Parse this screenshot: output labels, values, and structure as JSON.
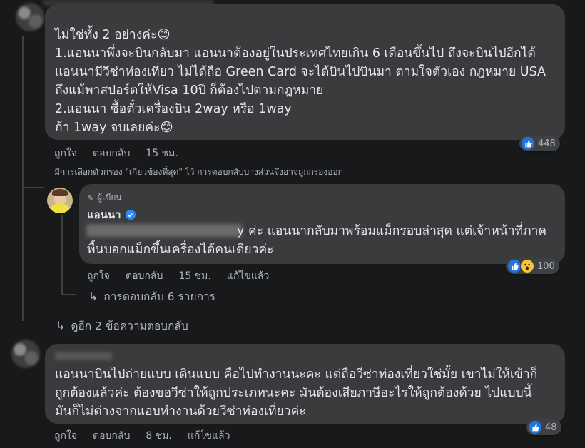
{
  "comment1": {
    "lines": [
      "ไม่ใช่ทั้ง 2 อย่างค่ะ😊",
      "1.แอนนาพึ่งจะบินกลับมา แอนนาต้องอยู่ในประเทศไทยเกิน 6 เดือนขึ้นไป ถึงจะบินไปอีกได้",
      "แอนนามีวีซ่าท่องเที่ยว ไม่ได้ถือ Green Card จะได้บินไปบินมา ตามใจตัวเอง กฎหมาย USA",
      "ถึงแม้พาสปอร์ตให้Visa 10ปี ก็ต้องไปตามกฎหมาย",
      "2.แอนนา ซื้อตั๋วเครื่องบิน 2way หรือ 1way",
      "ถ้า 1way จบเลยค่ะ😊"
    ],
    "actions": {
      "like": "ถูกใจ",
      "reply": "ตอบกลับ",
      "time": "15 ชม."
    },
    "reaction_count": "448"
  },
  "filter_notice": "มีการเลือกตัวกรอง \"เกี่ยวข้องที่สุด\" ไว้ การตอบกลับบางส่วนจึงอาจถูกกรองออก",
  "reply1": {
    "badge": "ผู้เขียน",
    "author": "แอนนา",
    "lines": [
      "y ค่ะ แอนนากลับมาพร้อมแม็กรอบล่าสุด แต่เจ้าหน้าที่ภาค",
      "พื้นบอกแม็กขึ้นเครื่องได้คนเดียวค่ะ"
    ],
    "actions": {
      "like": "ถูกใจ",
      "reply": "ตอบกลับ",
      "time": "15 ชม.",
      "edited": "แก้ไขแล้ว"
    },
    "reaction_count": "100",
    "more_replies": "การตอบกลับ 6 รายการ"
  },
  "view_more": "ดูอีก 2 ข้อความตอบกลับ",
  "comment2": {
    "lines": [
      "แอนนาบินไปถ่ายแบบ เดินแบบ คือไปทำงานนะคะ แต่ถือวีซ่าท่องเที่ยวใช่มั้ย เขาไม่ให้เข้าก็",
      "ถูกต้องแล้วค่ะ ต้องขอวีซ่าให้ถูกประเภทนะคะ มันต้องเสียภาษีอะไรให้ถูกต้องด้วย ไปแบบนี้",
      "มันก็ไม่ต่างจากแอบทำงานด้วยวีซ่าท่องเที่ยวค่ะ"
    ],
    "actions": {
      "like": "ถูกใจ",
      "reply": "ตอบกลับ",
      "time": "8 ชม.",
      "edited": "แก้ไขแล้ว"
    },
    "reaction_count": "48"
  },
  "colors": {
    "background": "#18191a",
    "bubble": "#3a3b3c",
    "like_blue": "#2374e1",
    "verified": "#2d88ff"
  }
}
